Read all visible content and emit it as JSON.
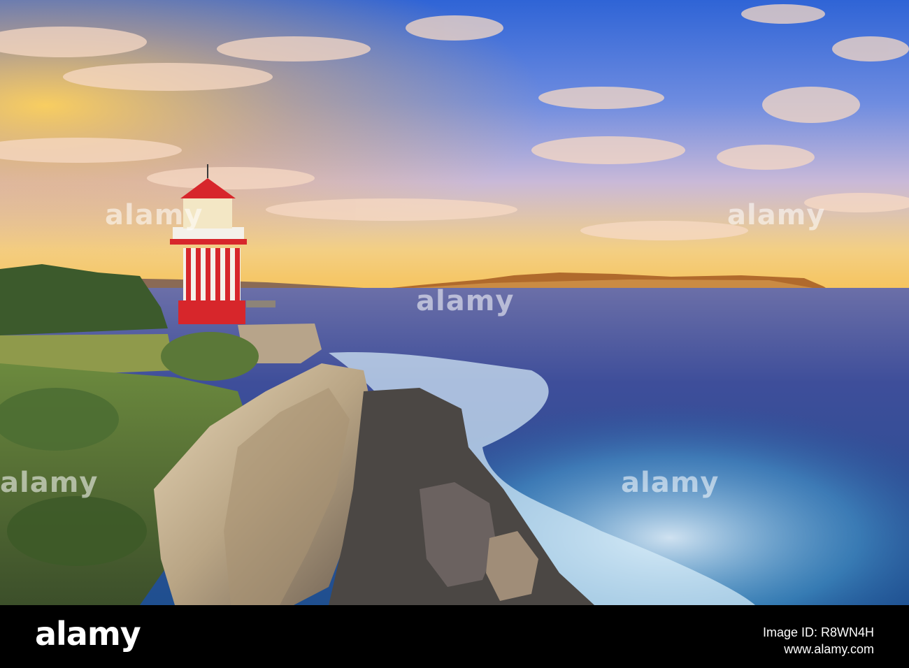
{
  "photo": {
    "subject": "Hornby Lighthouse on sandstone cliff at sunset overlooking harbour entrance",
    "colors": {
      "sky_top": "#3a6fd8",
      "sky_horizon": "#f6c35a",
      "sea": "#3c4f9c",
      "foam": "#cfe7f7",
      "cliff": "#cbb79a",
      "lighthouse_red": "#d7262b",
      "lighthouse_white": "#f4f1ea",
      "grass": "#5c7a3a",
      "headland": "#b8742f"
    }
  },
  "watermark": {
    "text": "alamy"
  },
  "footer": {
    "brand": "alamy",
    "image_id": "Image ID: R8WN4H",
    "site": "www.alamy.com",
    "background": "#000000"
  }
}
